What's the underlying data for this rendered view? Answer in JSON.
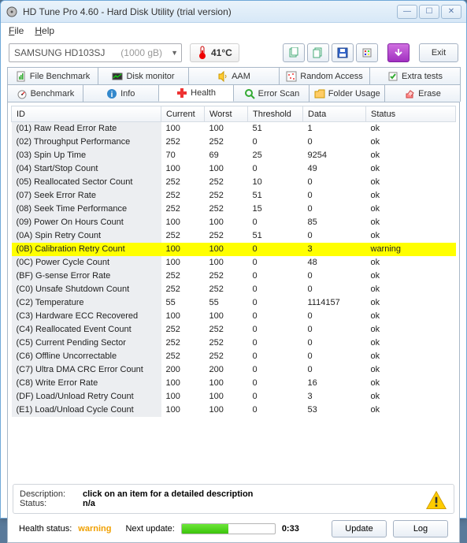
{
  "window": {
    "title": "HD Tune Pro 4.60 - Hard Disk Utility (trial version)"
  },
  "menu": {
    "file": "File",
    "help": "Help"
  },
  "toolbar": {
    "drive_name": "SAMSUNG HD103SJ",
    "drive_size": "(1000 gB)",
    "temperature": "41°C",
    "exit": "Exit"
  },
  "tabs_row1": [
    {
      "label": "File Benchmark"
    },
    {
      "label": "Disk monitor"
    },
    {
      "label": "AAM"
    },
    {
      "label": "Random Access"
    },
    {
      "label": "Extra tests"
    }
  ],
  "tabs_row2": [
    {
      "label": "Benchmark"
    },
    {
      "label": "Info"
    },
    {
      "label": "Health",
      "active": true
    },
    {
      "label": "Error Scan"
    },
    {
      "label": "Folder Usage"
    },
    {
      "label": "Erase"
    }
  ],
  "table": {
    "headers": {
      "id": "ID",
      "current": "Current",
      "worst": "Worst",
      "threshold": "Threshold",
      "data": "Data",
      "status": "Status"
    },
    "rows": [
      {
        "id": "(01) Raw Read Error Rate",
        "current": "100",
        "worst": "100",
        "threshold": "51",
        "data": "1",
        "status": "ok"
      },
      {
        "id": "(02) Throughput Performance",
        "current": "252",
        "worst": "252",
        "threshold": "0",
        "data": "0",
        "status": "ok"
      },
      {
        "id": "(03) Spin Up Time",
        "current": "70",
        "worst": "69",
        "threshold": "25",
        "data": "9254",
        "status": "ok"
      },
      {
        "id": "(04) Start/Stop Count",
        "current": "100",
        "worst": "100",
        "threshold": "0",
        "data": "49",
        "status": "ok"
      },
      {
        "id": "(05) Reallocated Sector Count",
        "current": "252",
        "worst": "252",
        "threshold": "10",
        "data": "0",
        "status": "ok"
      },
      {
        "id": "(07) Seek Error Rate",
        "current": "252",
        "worst": "252",
        "threshold": "51",
        "data": "0",
        "status": "ok"
      },
      {
        "id": "(08) Seek Time Performance",
        "current": "252",
        "worst": "252",
        "threshold": "15",
        "data": "0",
        "status": "ok"
      },
      {
        "id": "(09) Power On Hours Count",
        "current": "100",
        "worst": "100",
        "threshold": "0",
        "data": "85",
        "status": "ok"
      },
      {
        "id": "(0A) Spin Retry Count",
        "current": "252",
        "worst": "252",
        "threshold": "51",
        "data": "0",
        "status": "ok"
      },
      {
        "id": "(0B) Calibration Retry Count",
        "current": "100",
        "worst": "100",
        "threshold": "0",
        "data": "3",
        "status": "warning",
        "warn": true
      },
      {
        "id": "(0C) Power Cycle Count",
        "current": "100",
        "worst": "100",
        "threshold": "0",
        "data": "48",
        "status": "ok"
      },
      {
        "id": "(BF) G-sense Error Rate",
        "current": "252",
        "worst": "252",
        "threshold": "0",
        "data": "0",
        "status": "ok"
      },
      {
        "id": "(C0) Unsafe Shutdown Count",
        "current": "252",
        "worst": "252",
        "threshold": "0",
        "data": "0",
        "status": "ok"
      },
      {
        "id": "(C2) Temperature",
        "current": "55",
        "worst": "55",
        "threshold": "0",
        "data": "1114157",
        "status": "ok"
      },
      {
        "id": "(C3) Hardware ECC Recovered",
        "current": "100",
        "worst": "100",
        "threshold": "0",
        "data": "0",
        "status": "ok"
      },
      {
        "id": "(C4) Reallocated Event Count",
        "current": "252",
        "worst": "252",
        "threshold": "0",
        "data": "0",
        "status": "ok"
      },
      {
        "id": "(C5) Current Pending Sector",
        "current": "252",
        "worst": "252",
        "threshold": "0",
        "data": "0",
        "status": "ok"
      },
      {
        "id": "(C6) Offline Uncorrectable",
        "current": "252",
        "worst": "252",
        "threshold": "0",
        "data": "0",
        "status": "ok"
      },
      {
        "id": "(C7) Ultra DMA CRC Error Count",
        "current": "200",
        "worst": "200",
        "threshold": "0",
        "data": "0",
        "status": "ok"
      },
      {
        "id": "(C8) Write Error Rate",
        "current": "100",
        "worst": "100",
        "threshold": "0",
        "data": "16",
        "status": "ok"
      },
      {
        "id": "(DF) Load/Unload Retry Count",
        "current": "100",
        "worst": "100",
        "threshold": "0",
        "data": "3",
        "status": "ok"
      },
      {
        "id": "(E1) Load/Unload Cycle Count",
        "current": "100",
        "worst": "100",
        "threshold": "0",
        "data": "53",
        "status": "ok"
      }
    ]
  },
  "detail": {
    "desc_label": "Description:",
    "desc_value": "click on an item for a detailed description",
    "status_label": "Status:",
    "status_value": "n/a"
  },
  "footer": {
    "health_label": "Health status:",
    "health_value": "warning",
    "next_update_label": "Next update:",
    "countdown": "0:33",
    "update": "Update",
    "log": "Log"
  }
}
